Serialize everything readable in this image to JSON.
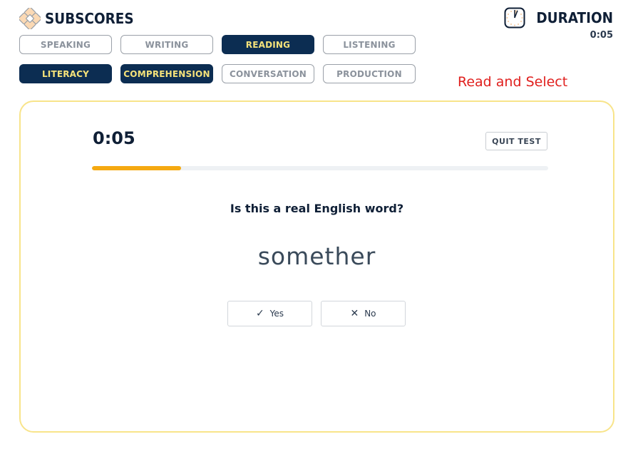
{
  "header": {
    "brand_title": "SUBSCORES",
    "brand_icon": "subscores-logo-icon",
    "duration_label": "DURATION",
    "duration_icon": "clock-icon",
    "duration_time": "0:05"
  },
  "subscores": {
    "row1": [
      {
        "label": "SPEAKING",
        "active": false
      },
      {
        "label": "WRITING",
        "active": false
      },
      {
        "label": "READING",
        "active": true
      },
      {
        "label": "LISTENING",
        "active": false
      }
    ],
    "row2": [
      {
        "label": "LITERACY",
        "active": true
      },
      {
        "label": "COMPREHENSION",
        "active": true
      },
      {
        "label": "CONVERSATION",
        "active": false
      },
      {
        "label": "PRODUCTION",
        "active": false
      }
    ]
  },
  "instruction": "Read and Select",
  "test": {
    "timer": "0:05",
    "quit_label": "QUIT TEST",
    "progress_fraction": 0.195,
    "question": "Is this a real English word?",
    "word": "somether",
    "answers": {
      "yes_label": "Yes",
      "yes_icon": "check-icon",
      "no_label": "No",
      "no_icon": "x-icon"
    }
  },
  "colors": {
    "active_bg": "#0c2d52",
    "active_text": "#f5e27a",
    "progress": "#f5a911",
    "card_border": "#f8e48a",
    "instruction": "#e0201e"
  }
}
